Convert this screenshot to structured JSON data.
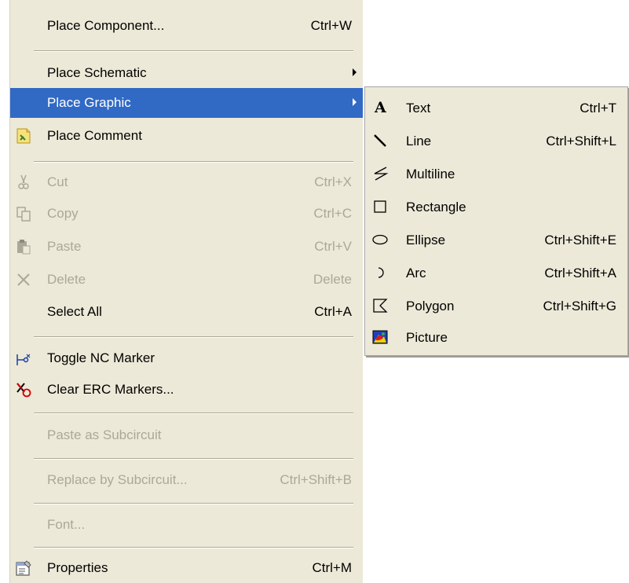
{
  "main_menu": {
    "items": [
      {
        "label": "Place Component...",
        "shortcut": "Ctrl+W"
      },
      {
        "label": "Place Schematic",
        "shortcut": ""
      },
      {
        "label": "Place Graphic",
        "shortcut": ""
      },
      {
        "label": "Place Comment",
        "shortcut": ""
      },
      {
        "label": "Cut",
        "shortcut": "Ctrl+X"
      },
      {
        "label": "Copy",
        "shortcut": "Ctrl+C"
      },
      {
        "label": "Paste",
        "shortcut": "Ctrl+V"
      },
      {
        "label": "Delete",
        "shortcut": "Delete"
      },
      {
        "label": "Select All",
        "shortcut": "Ctrl+A"
      },
      {
        "label": "Toggle NC Marker",
        "shortcut": ""
      },
      {
        "label": "Clear ERC Markers...",
        "shortcut": ""
      },
      {
        "label": "Paste as Subcircuit",
        "shortcut": ""
      },
      {
        "label": "Replace by Subcircuit...",
        "shortcut": "Ctrl+Shift+B"
      },
      {
        "label": "Font...",
        "shortcut": ""
      },
      {
        "label": "Properties",
        "shortcut": "Ctrl+M"
      }
    ]
  },
  "sub_menu": {
    "items": [
      {
        "label": "Text",
        "shortcut": "Ctrl+T",
        "icon": "A"
      },
      {
        "label": "Line",
        "shortcut": "Ctrl+Shift+L"
      },
      {
        "label": "Multiline",
        "shortcut": ""
      },
      {
        "label": "Rectangle",
        "shortcut": ""
      },
      {
        "label": "Ellipse",
        "shortcut": "Ctrl+Shift+E"
      },
      {
        "label": "Arc",
        "shortcut": "Ctrl+Shift+A"
      },
      {
        "label": "Polygon",
        "shortcut": "Ctrl+Shift+G"
      },
      {
        "label": "Picture",
        "shortcut": ""
      }
    ]
  },
  "colors": {
    "menu_bg": "#ece9d8",
    "highlight": "#316ac5",
    "disabled_text": "#aca899"
  }
}
